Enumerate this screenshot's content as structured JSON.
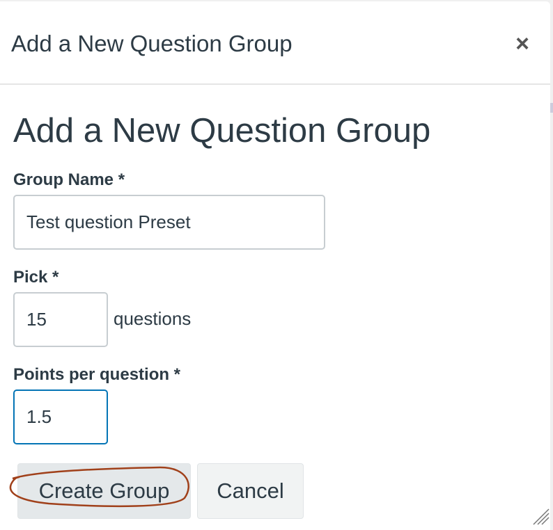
{
  "dialog": {
    "title": "Add a New Question Group",
    "close_icon": "close-icon",
    "heading": "Add a New Question Group",
    "group_name": {
      "label": "Group Name *",
      "value": "Test question Preset"
    },
    "pick": {
      "label": "Pick *",
      "value": "15",
      "suffix": "questions"
    },
    "points": {
      "label": "Points per question *",
      "value": "1.5"
    },
    "buttons": {
      "create": "Create Group",
      "cancel": "Cancel"
    },
    "annotation_color": "#a0401a"
  }
}
